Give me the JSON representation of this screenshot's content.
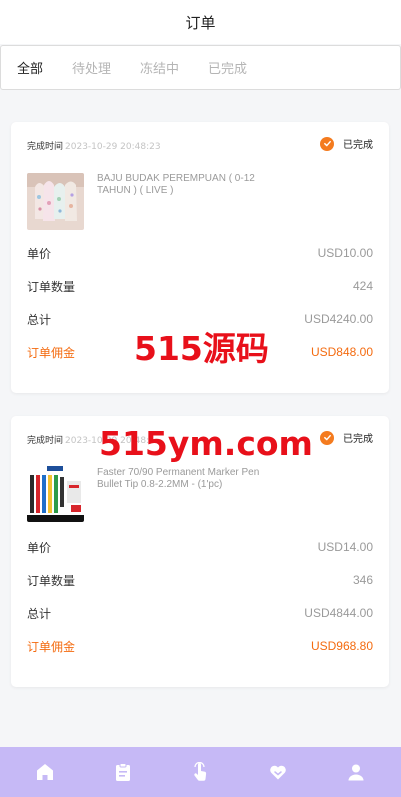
{
  "header": {
    "title": "订单"
  },
  "tabs": [
    {
      "label": "全部",
      "active": true
    },
    {
      "label": "待处理",
      "active": false
    },
    {
      "label": "冻结中",
      "active": false
    },
    {
      "label": "已完成",
      "active": false
    }
  ],
  "orders": [
    {
      "time_label": "完成时间",
      "time": "2023-10-29 20:48:23",
      "status": "已完成",
      "product_name": "BAJU BUDAK PEREMPUAN ( 0-12 TAHUN ) ( LIVE )",
      "unit_price_label": "单价",
      "unit_price": "USD10.00",
      "quantity_label": "订单数量",
      "quantity": "424",
      "total_label": "总计",
      "total": "USD4240.00",
      "commission_label": "订单佣金",
      "commission": "USD848.00"
    },
    {
      "time_label": "完成时间",
      "time": "2023-10-29 20:48:1",
      "status": "已完成",
      "product_name": "Faster 70/90 Permanent Marker Pen Bullet Tip 0.8-2.2MM - (1'pc)",
      "unit_price_label": "单价",
      "unit_price": "USD14.00",
      "quantity_label": "订单数量",
      "quantity": "346",
      "total_label": "总计",
      "total": "USD4844.00",
      "commission_label": "订单佣金",
      "commission": "USD968.80"
    }
  ],
  "watermarks": {
    "first": "515源码",
    "second": "515ym.com"
  },
  "bottom_nav": [
    "home-icon",
    "clipboard-icon",
    "tap-hand-icon",
    "heart-icon",
    "user-icon"
  ],
  "colors": {
    "accent": "#f46b10",
    "nav_bg": "#c6b9f6",
    "watermark": "#e8101a"
  }
}
